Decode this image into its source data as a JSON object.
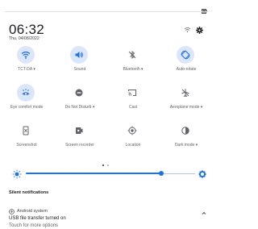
{
  "status": {
    "battery_icon": "battery-icon"
  },
  "header": {
    "time": "06:32",
    "date": "Thu, 04/08/2022",
    "wifi_icon": "wifi-small-icon",
    "settings_icon": "gear-icon"
  },
  "tiles": [
    {
      "label": "TCT-DA ▾",
      "icon": "wifi-icon",
      "active": true
    },
    {
      "label": "Sound",
      "icon": "volume-icon",
      "active": true
    },
    {
      "label": "Bluetooth ▾",
      "icon": "bluetooth-off-icon",
      "active": false
    },
    {
      "label": "Auto-rotate",
      "icon": "auto-rotate-icon",
      "active": true
    },
    {
      "label": "Eye comfort mode",
      "icon": "eye-comfort-icon",
      "active": true
    },
    {
      "label": "Do Not Disturb ▾",
      "icon": "do-not-disturb-icon",
      "active": false
    },
    {
      "label": "Cast",
      "icon": "cast-icon",
      "active": false
    },
    {
      "label": "Aeroplane mode ▾",
      "icon": "airplane-icon",
      "active": false
    },
    {
      "label": "Screenshot",
      "icon": "screenshot-icon",
      "active": false
    },
    {
      "label": "Screen recorder",
      "icon": "screen-recorder-icon",
      "active": false
    },
    {
      "label": "Location",
      "icon": "location-icon",
      "active": false
    },
    {
      "label": "Dark mode ▾",
      "icon": "dark-mode-icon",
      "active": false
    }
  ],
  "brightness": {
    "level": 0.8
  },
  "notifications": {
    "section_title": "Silent notifications",
    "app_name": "Android system",
    "title": "USB file transfer turned on",
    "body": "Touch for more options"
  },
  "colors": {
    "accent": "#1a73e8",
    "tile_active_bg": "#dce6fb"
  }
}
